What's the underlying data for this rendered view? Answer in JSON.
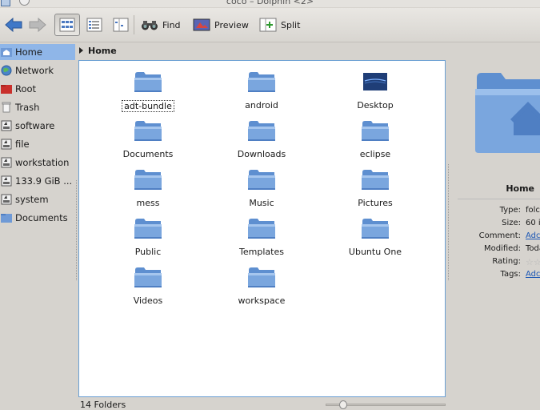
{
  "window": {
    "title": "coco – Dolphin <2>"
  },
  "toolbar": {
    "find_label": "Find",
    "preview_label": "Preview",
    "split_label": "Split"
  },
  "places": [
    {
      "label": "Home",
      "icon": "home-folder-icon",
      "selected": true
    },
    {
      "label": "Network",
      "icon": "network-icon"
    },
    {
      "label": "Root",
      "icon": "root-folder-icon"
    },
    {
      "label": "Trash",
      "icon": "trash-icon"
    },
    {
      "label": "software",
      "icon": "drive-icon"
    },
    {
      "label": "file",
      "icon": "drive-icon"
    },
    {
      "label": "workstation",
      "icon": "drive-icon"
    },
    {
      "label": "133.9 GiB ...",
      "icon": "drive-icon"
    },
    {
      "label": "system",
      "icon": "drive-icon"
    },
    {
      "label": "Documents",
      "icon": "folder-icon"
    }
  ],
  "breadcrumb": {
    "current": "Home"
  },
  "files": [
    {
      "name": "adt-bundle",
      "icon": "folder-icon",
      "focused": true
    },
    {
      "name": "android",
      "icon": "folder-icon"
    },
    {
      "name": "Desktop",
      "icon": "desktop-folder-icon"
    },
    {
      "name": "Documents",
      "icon": "folder-icon"
    },
    {
      "name": "Downloads",
      "icon": "folder-icon"
    },
    {
      "name": "eclipse",
      "icon": "folder-icon"
    },
    {
      "name": "mess",
      "icon": "folder-icon"
    },
    {
      "name": "Music",
      "icon": "folder-icon"
    },
    {
      "name": "Pictures",
      "icon": "folder-icon"
    },
    {
      "name": "Public",
      "icon": "folder-icon"
    },
    {
      "name": "Templates",
      "icon": "folder-icon"
    },
    {
      "name": "Ubuntu One",
      "icon": "folder-icon"
    },
    {
      "name": "Videos",
      "icon": "folder-icon"
    },
    {
      "name": "workspace",
      "icon": "folder-icon"
    }
  ],
  "status": {
    "text": "14 Folders"
  },
  "info": {
    "name": "Home",
    "properties": [
      {
        "key": "Type:",
        "value": "folc"
      },
      {
        "key": "Size:",
        "value": "60 i"
      },
      {
        "key": "Comment:",
        "value": "Adc",
        "link": true
      },
      {
        "key": "Modified:",
        "value": "Toda"
      },
      {
        "key": "Rating:",
        "value": "",
        "rating": true
      },
      {
        "key": "Tags:",
        "value": "Adc",
        "link": true
      }
    ]
  },
  "colors": {
    "accent": "#8fb6e8",
    "folder": "#7aa6de",
    "link": "#1c57b5"
  }
}
